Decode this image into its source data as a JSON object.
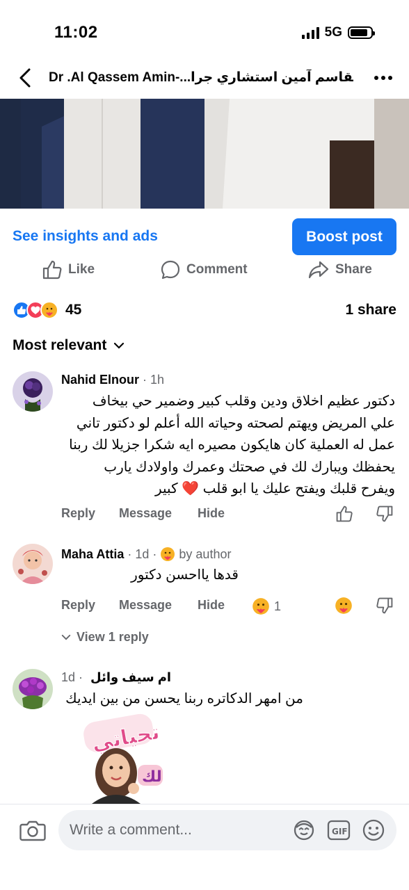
{
  "status_bar": {
    "time": "11:02",
    "network": "5G"
  },
  "header": {
    "title": "Dr .Al Qassem Amin-...د.القاسم آمين استشاري جرا"
  },
  "post_actions": {
    "insights_link": "See insights and ads",
    "boost_button": "Boost post",
    "like_label": "Like",
    "comment_label": "Comment",
    "share_label": "Share"
  },
  "reactions": {
    "count": "45",
    "shares": "1 share",
    "types": [
      "like",
      "love",
      "care"
    ]
  },
  "sort": {
    "label": "Most relevant"
  },
  "comments": [
    {
      "author": "Nahid Elnour",
      "time": "· 1h",
      "text_lines": [
        "دكتور عظيم اخلاق ودين وقلب كبير وضمير حي بيخاف",
        "علي المريض ويهتم لصحته وحياته الله أعلم لو دكتور تاني",
        "عمل له العملية كان هايكون مصيره ايه شكرا جزيلا لك ربنا",
        "يحفظك ويبارك لك في صحتك وعمرك واولادك يارب",
        "ويفرح قلبك ويفتح عليك يا ابو قلب ❤️ كبير"
      ],
      "actions": {
        "reply": "Reply",
        "message": "Message",
        "hide": "Hide"
      }
    },
    {
      "author": "Maha Attia",
      "time": "· 1d ·",
      "badge": "by author",
      "text": "قدها يااحسن دكتور",
      "reaction_count": "1",
      "actions": {
        "reply": "Reply",
        "message": "Message",
        "hide": "Hide"
      },
      "view_replies": "View 1 reply"
    },
    {
      "author": "ام سيف وائل",
      "time": "1d ·",
      "text": "من امهر الدكاتره ربنا يحسن من بين ايديك",
      "sticker_text_top": "تحياتي",
      "sticker_text_bottom": "لك"
    }
  ],
  "composer": {
    "placeholder": "Write a comment...",
    "gif_label": "GIF"
  },
  "colors": {
    "accent": "#1877f2",
    "secondary_text": "#65676b",
    "love": "#f33e58",
    "care": "#f7b125"
  }
}
